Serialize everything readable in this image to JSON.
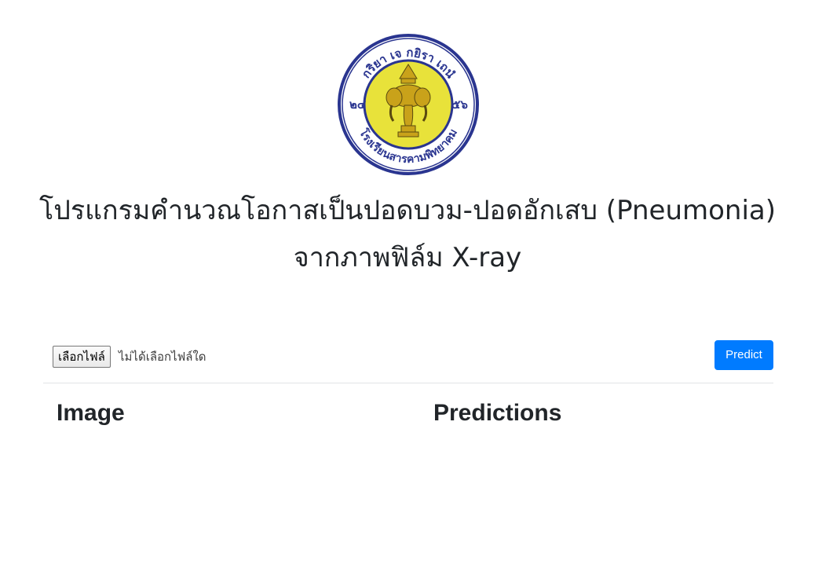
{
  "logo": {
    "top_text": "กริยา เจ กยิรา เถนํ",
    "left_numeral": "๒๔",
    "right_numeral": "๕๖",
    "bottom_text": "โรงเรียนสารคามพิทยาคม",
    "colors": {
      "ring": "#2a3590",
      "inner": "#e8e23a",
      "emblem": "#c9a21a"
    }
  },
  "title": {
    "line1": "โปรแกรมคำนวณโอกาสเป็นปอดบวม-ปอดอักเสบ (Pneumonia)",
    "line2": "จากภาพฟิล์ม X-ray"
  },
  "upload": {
    "file_button_label": "เลือกไฟล์",
    "file_status": "ไม่ได้เลือกไฟล์ใด",
    "predict_label": "Predict"
  },
  "columns": {
    "image_heading": "Image",
    "predictions_heading": "Predictions"
  },
  "colors": {
    "primary": "#007bff",
    "text": "#212529"
  }
}
